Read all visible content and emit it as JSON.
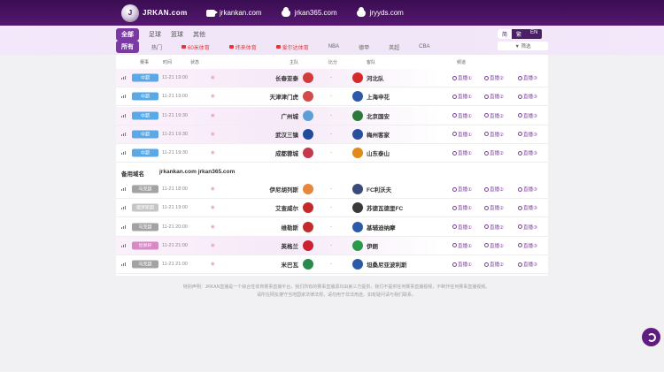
{
  "header": {
    "logo_text": "JRKAN.com",
    "domains": [
      {
        "icon": "video-icon",
        "label": "jrkankan.com"
      },
      {
        "icon": "cloud-icon",
        "label": "jrkan365.com"
      },
      {
        "icon": "cloud-icon",
        "label": "jryyds.com"
      }
    ]
  },
  "nav": {
    "row1": [
      "全部",
      "足球",
      "篮球",
      "其他"
    ],
    "row2": [
      {
        "label": "所有",
        "active": true
      },
      {
        "label": "热门"
      },
      {
        "label": "60米体育",
        "red": true
      },
      {
        "label": "纬来体育",
        "red": true
      },
      {
        "label": "爱尔达体育",
        "red": true
      },
      {
        "label": "NBA"
      },
      {
        "label": "德甲"
      },
      {
        "label": "英超"
      },
      {
        "label": "CBA"
      }
    ],
    "lang": [
      "简",
      "繁",
      "EN"
    ],
    "filter_label": "▼ 筛选"
  },
  "table": {
    "headers": {
      "event": "赛事",
      "time": "时间",
      "status": "状态",
      "home": "主队",
      "score": "比分",
      "away": "客队",
      "stream": "频道"
    },
    "links": [
      "直播①",
      "直播②",
      "直播③"
    ],
    "rows": [
      {
        "event": "中超",
        "time": "11-21 19:00",
        "home": "长春亚泰",
        "score": "-",
        "away": "河北队",
        "badge_color": "#5aa8e6",
        "home_color": "#d23b3b",
        "away_color": "#d42a2a",
        "pink": true
      },
      {
        "event": "中超",
        "time": "11-21 19:00",
        "home": "天津津门虎",
        "score": "-",
        "away": "上海申花",
        "badge_color": "#5aa8e6",
        "home_color": "#d24a4a",
        "away_color": "#2c5aa8",
        "pink": false
      },
      {
        "event": "中超",
        "time": "11-21 19:30",
        "home": "广州城",
        "score": "-",
        "away": "北京国安",
        "badge_color": "#5aa8e6",
        "home_color": "#5b9fd8",
        "away_color": "#2b7a3a",
        "pink": true
      },
      {
        "event": "中超",
        "time": "11-21 19:30",
        "home": "武汉三镇",
        "score": "-",
        "away": "梅州客家",
        "badge_color": "#5aa8e6",
        "home_color": "#1f4b9a",
        "away_color": "#2a4e9e",
        "pink": true
      },
      {
        "event": "中超",
        "time": "11-21 19:30",
        "home": "成都蓉城",
        "score": "-",
        "away": "山东泰山",
        "badge_color": "#5aa8e6",
        "home_color": "#c43a4a",
        "away_color": "#e08a1a",
        "pink": false
      }
    ],
    "backup": {
      "label": "备用域名",
      "value": "jrkankan.com jrkan365.com"
    },
    "rows2": [
      {
        "event": "乌克超",
        "time": "11-21 18:00",
        "home": "伊尼胡列斯",
        "score": "-",
        "away": "FC利沃夫",
        "badge_color": "#a3a3a3",
        "home_color": "#e8863a",
        "away_color": "#3a4a7a",
        "pink": false
      },
      {
        "event": "俄罗斯超",
        "time": "11-21 19:00",
        "home": "艾查威尔",
        "score": "-",
        "away": "苏德瓦德里FC",
        "badge_color": "#c6c6c6",
        "home_color": "#c42a2a",
        "away_color": "#3a3a3a",
        "pink": false
      },
      {
        "event": "乌克超",
        "time": "11-21 20:00",
        "home": "维勒斯",
        "score": "-",
        "away": "基辅迪纳摩",
        "badge_color": "#a3a3a3",
        "home_color": "#c42a2a",
        "away_color": "#2a5aa8",
        "pink": false
      },
      {
        "event": "世界杯",
        "time": "11-21 21:00",
        "home": "英格兰",
        "score": "-",
        "away": "伊朗",
        "badge_color": "#d78bc5",
        "home_color": "#cc1f2f",
        "away_color": "#2a9a4a",
        "pink": true
      },
      {
        "event": "乌克超",
        "time": "11-21 21:00",
        "home": "米巴瓦",
        "score": "-",
        "away": "坦桑尼亚波利斯",
        "badge_color": "#a3a3a3",
        "home_color": "#2a8a4a",
        "away_color": "#2a5aa8",
        "pink": false
      }
    ]
  },
  "footer": {
    "line1": "特别声明：JRKAN直播是一个综合性体育赛事直播平台，我们所有的赛事直播源均由第三方提供，我们不提供任何赛事直播视频，不制作任何赛事直播视频。",
    "line2": "请所在网友遵守当地国家法律法规，请勿用于非法用途。如有疑问请与我们联系。"
  }
}
